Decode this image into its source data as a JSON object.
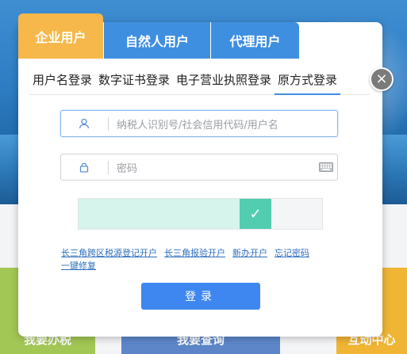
{
  "background": {
    "tiles": [
      {
        "label": "我要办税"
      },
      {
        "label": "我要查询"
      },
      {
        "label": "互动中心"
      }
    ]
  },
  "user_tabs": [
    {
      "label": "企业用户",
      "active": true
    },
    {
      "label": "自然人用户",
      "active": false
    },
    {
      "label": "代理用户",
      "active": false
    }
  ],
  "close_glyph": "×",
  "login_tabs": [
    {
      "label": "用户名登录",
      "active": false
    },
    {
      "label": "数字证书登录",
      "active": false
    },
    {
      "label": "电子营业执照登录",
      "active": false
    },
    {
      "label": "原方式登录",
      "active": true
    }
  ],
  "fields": {
    "username": {
      "placeholder": "纳税人识别号/社会信用代码/用户名",
      "icon": "user-icon"
    },
    "password": {
      "placeholder": "密码",
      "icon": "lock-icon",
      "trailing_icon": "keyboard-icon"
    }
  },
  "slider": {
    "progress": 1.0,
    "status_glyph": "✓",
    "status": "verified"
  },
  "links": [
    "长三角跨区税源登记开户",
    "长三角报验开户",
    "新办开户",
    "忘记密码",
    "一键修复"
  ],
  "login_button": "登录",
  "colors": {
    "accent": "#3f87f0",
    "tab_active": "#f6b84a",
    "tab_inactive": "#3f8fe0",
    "slider_handle": "#52cdb0",
    "slider_fill": "#d6f4ec",
    "link": "#2d6fbf"
  }
}
